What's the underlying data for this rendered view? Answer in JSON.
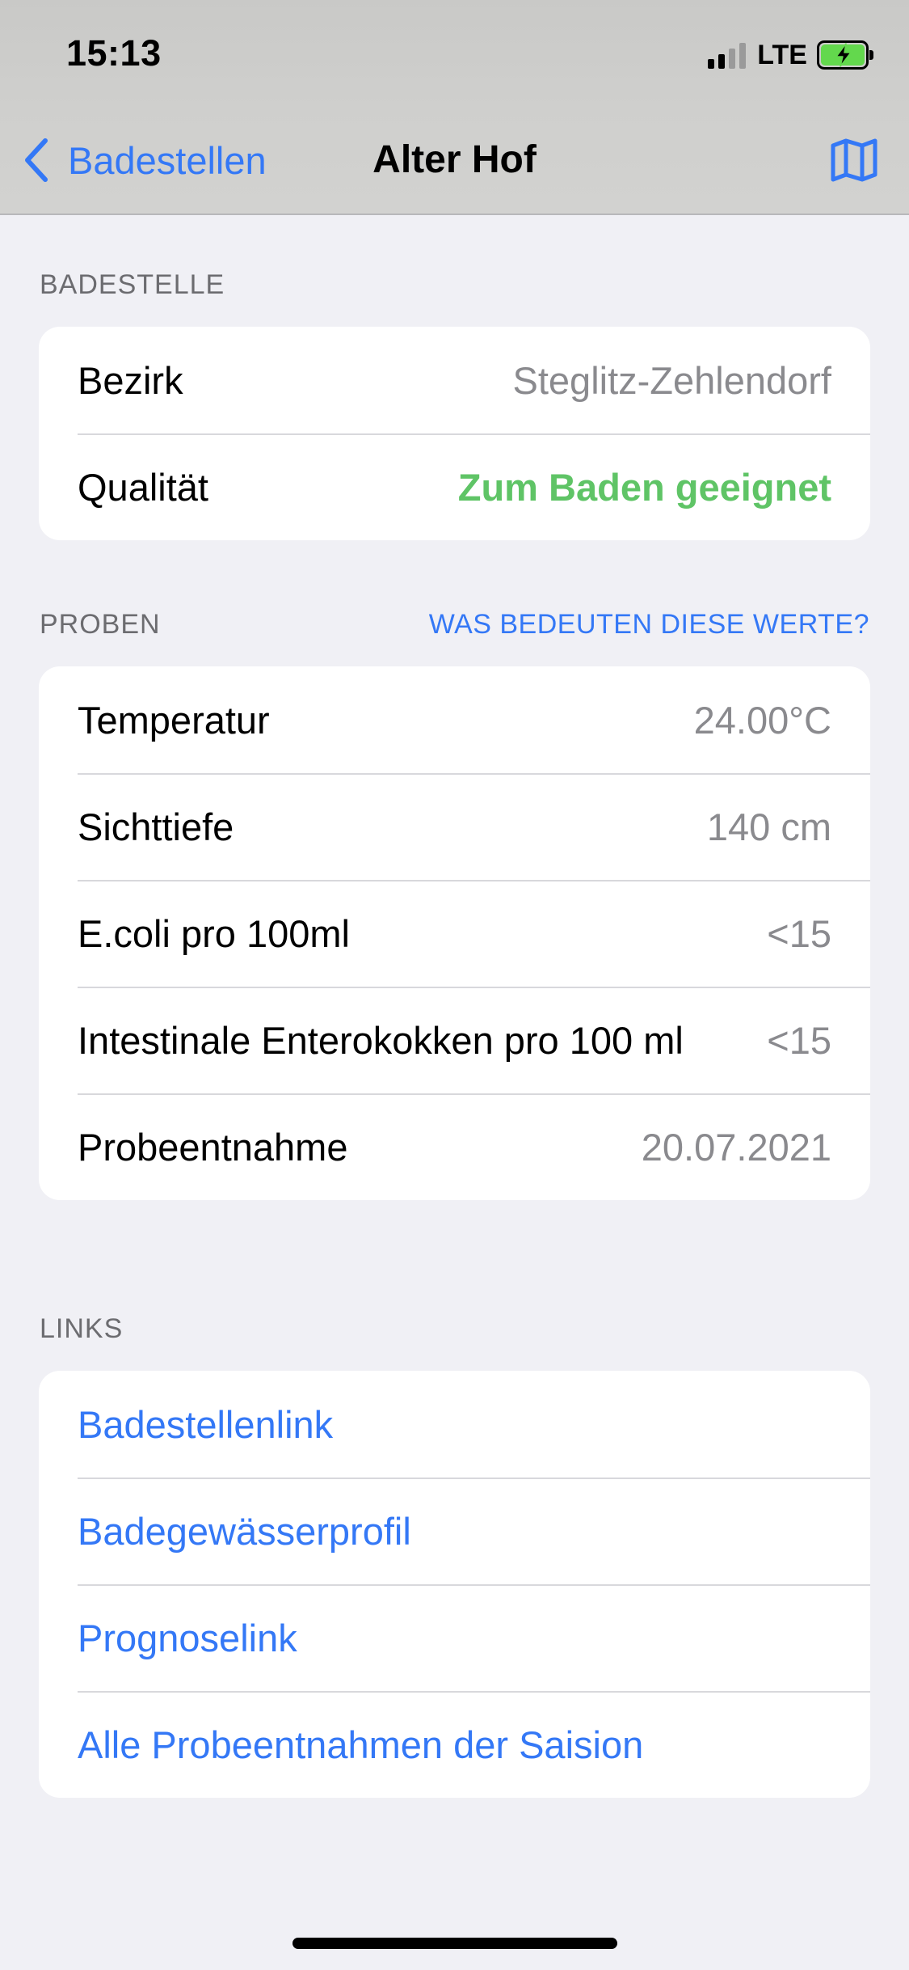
{
  "status_bar": {
    "time": "15:13",
    "network": "LTE",
    "signal_bars_active": 2,
    "signal_bars_total": 4,
    "battery_charging": true,
    "battery_color": "#63d84d"
  },
  "nav": {
    "back_label": "Badestellen",
    "title": "Alter Hof",
    "map_icon": "map-icon",
    "accent": "#3478f6"
  },
  "sections": {
    "badestelle": {
      "header": "BADESTELLE",
      "rows": [
        {
          "label": "Bezirk",
          "value": "Steglitz-Zehlendorf"
        },
        {
          "label": "Qualität",
          "value": "Zum Baden geeignet",
          "value_color": "#5fc466"
        }
      ]
    },
    "proben": {
      "header": "PROBEN",
      "header_link": "WAS BEDEUTEN DIESE WERTE?",
      "rows": [
        {
          "label": "Temperatur",
          "value": "24.00°C"
        },
        {
          "label": "Sichttiefe",
          "value": "140 cm"
        },
        {
          "label": "E.coli pro 100ml",
          "value": "<15"
        },
        {
          "label": "Intestinale Enterokokken pro 100 ml",
          "value": "<15"
        },
        {
          "label": "Probeentnahme",
          "value": "20.07.2021"
        }
      ]
    },
    "links": {
      "header": "LINKS",
      "items": [
        "Badestellenlink",
        "Badegewässerprofil",
        "Prognoselink",
        "Alle Probeentnahmen der Saision"
      ]
    }
  }
}
